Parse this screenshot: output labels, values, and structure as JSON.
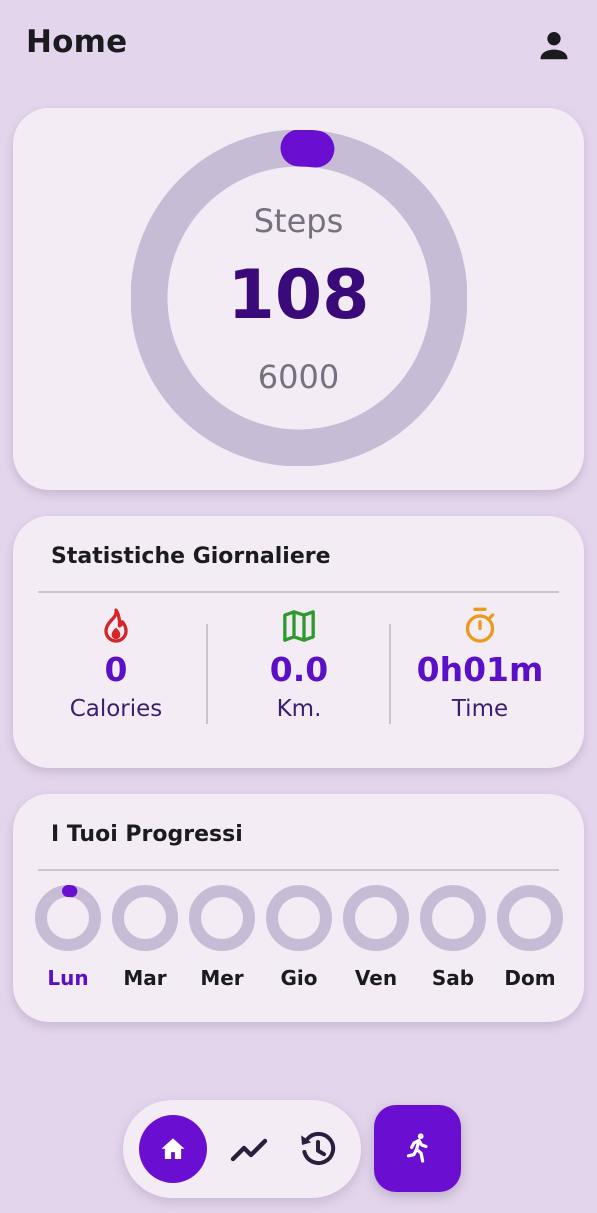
{
  "header": {
    "title": "Home"
  },
  "steps": {
    "label": "Steps",
    "value": "108",
    "goal": "6000",
    "progress_fraction": 0.018,
    "colors": {
      "track": "#c7bcd6",
      "progress": "#6a0fd1"
    }
  },
  "daily_stats": {
    "title": "Statistiche Giornaliere",
    "items": [
      {
        "icon": "flame-icon",
        "value": "0",
        "label": "Calories",
        "icon_color": "#d32626"
      },
      {
        "icon": "map-icon",
        "value": "0.0",
        "label": "Km.",
        "icon_color": "#2e9a2e"
      },
      {
        "icon": "stopwatch-icon",
        "value": "0h01m",
        "label": "Time",
        "icon_color": "#e89b1e"
      }
    ]
  },
  "progress": {
    "title": "I Tuoi Progressi",
    "days": [
      {
        "label": "Lun",
        "active": true,
        "progress_fraction": 0.02
      },
      {
        "label": "Mar",
        "active": false,
        "progress_fraction": 0
      },
      {
        "label": "Mer",
        "active": false,
        "progress_fraction": 0
      },
      {
        "label": "Gio",
        "active": false,
        "progress_fraction": 0
      },
      {
        "label": "Ven",
        "active": false,
        "progress_fraction": 0
      },
      {
        "label": "Sab",
        "active": false,
        "progress_fraction": 0
      },
      {
        "label": "Dom",
        "active": false,
        "progress_fraction": 0
      }
    ]
  },
  "bottom_nav": {
    "items": [
      {
        "icon": "home-icon",
        "selected": true
      },
      {
        "icon": "trending-icon",
        "selected": false
      },
      {
        "icon": "history-icon",
        "selected": false
      }
    ],
    "action_icon": "run-icon"
  },
  "colors": {
    "background": "#e3d6ec",
    "card": "#f3ecf4",
    "accent": "#6a0fd1"
  }
}
